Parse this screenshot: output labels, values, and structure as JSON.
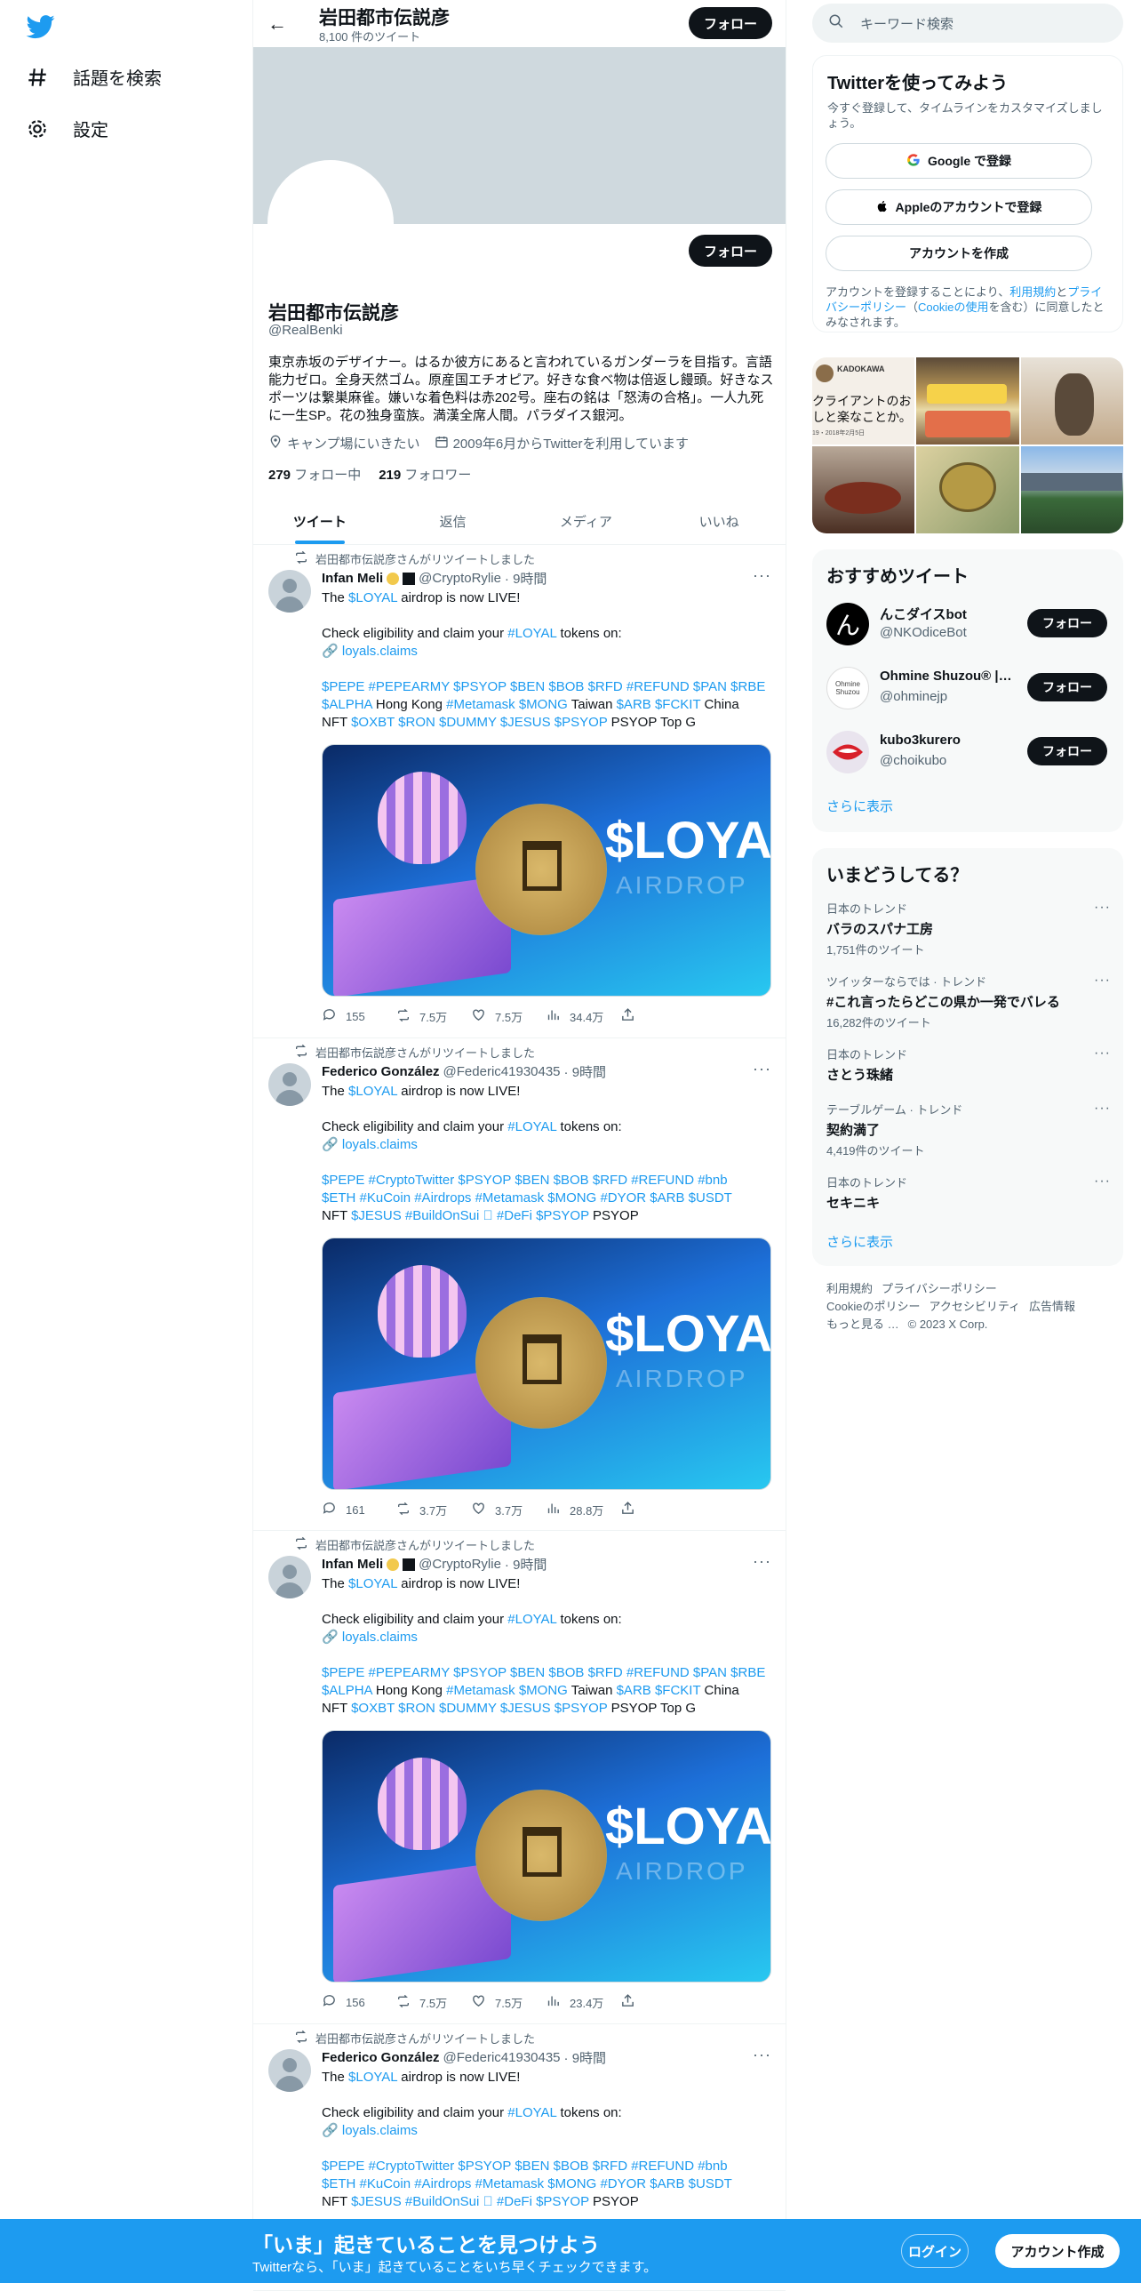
{
  "nav": {
    "items": [
      {
        "label": "話題を検索",
        "icon": "hashtag-icon"
      },
      {
        "label": "設定",
        "icon": "gear-icon"
      }
    ]
  },
  "topbar": {
    "title": "岩田都市伝説彦",
    "subtitle": "8,100 件のツイート",
    "follow": "フォロー"
  },
  "profile": {
    "follow": "フォロー",
    "name": "岩田都市伝説彦",
    "handle": "@RealBenki",
    "bio": "東京赤坂のデザイナー。はるか彼方にあると言われているガンダーラを目指す。言語能力ゼロ。全身天然ゴム。原産国エチオピア。好きな食べ物は倍返し饅頭。好きなスポーツは繋巣麻雀。嫌いな着色料は赤202号。座右の銘は「怒涛の合格」。一人九死に一生SP。花の独身蛮族。満漢全席人間。パラダイス銀河。",
    "location": "キャンプ場にいきたい",
    "joined": "2009年6月からTwitterを利用しています",
    "following_count": "279",
    "following_label": "フォロー中",
    "followers_count": "219",
    "followers_label": "フォロワー"
  },
  "tabs": [
    "ツイート",
    "返信",
    "メディア",
    "いいね"
  ],
  "tweets": [
    {
      "rt": "岩田都市伝説彦さんがリツイートしました",
      "name": "Infan Meli",
      "handle": "@CryptoRylie",
      "time": "· 9時間",
      "line1a": "The ",
      "line1b": "$LOYAL",
      "line1c": " airdrop is now LIVE!",
      "line2a": "Check eligibility and claim your ",
      "line2b": "#LOYAL",
      "line2c": " tokens on:",
      "link": "loyals.claims",
      "tags1": "$PEPE #PEPEARMY $PSYOP $BEN $BOB $RFD #REFUND $PAN $RBE",
      "tags2a": "$ALPHA",
      "tags2b": " Hong Kong ",
      "tags2c": "#Metamask $MONG",
      "tags2d": " Taiwan ",
      "tags2e": "$ARB $FCKIT",
      "tags2f": " China",
      "tags3a": "NFT ",
      "tags3b": "$OXBT $RON $DUMMY $JESUS $PSYOP",
      "tags3c": " PSYOP Top G",
      "image_text": "$LOYAL",
      "image_sub": "AIRDROP",
      "replies": "155",
      "retweets": "7.5万",
      "likes": "7.5万",
      "views": "34.4万"
    },
    {
      "rt": "岩田都市伝説彦さんがリツイートしました",
      "name": "Federico González",
      "handle": "@Federic41930435",
      "time": "· 9時間",
      "line1a": "The ",
      "line1b": "$LOYAL",
      "line1c": " airdrop is now LIVE!",
      "line2a": "Check eligibility and claim your ",
      "line2b": "#LOYAL",
      "line2c": " tokens on:",
      "link": "loyals.claims",
      "tags1": "$PEPE #CryptoTwitter $PSYOP $BEN $BOB $RFD #REFUND  #bnb",
      "tags2a": "$ETH  #KuCoin #Airdrops #Metamask $MONG #DYOR $ARB $USDT",
      "tags2b": "",
      "tags2c": "",
      "tags2d": "",
      "tags2e": "",
      "tags2f": "",
      "tags3a": "NFT ",
      "tags3b": "$JESUS #BuildOnSui ⃠ #DeFi $PSYOP",
      "tags3c": " PSYOP",
      "image_text": "$LOYAL",
      "image_sub": "AIRDROP",
      "replies": "161",
      "retweets": "3.7万",
      "likes": "3.7万",
      "views": "28.8万"
    },
    {
      "rt": "岩田都市伝説彦さんがリツイートしました",
      "name": "Infan Meli",
      "handle": "@CryptoRylie",
      "time": "· 9時間",
      "line1a": "The ",
      "line1b": "$LOYAL",
      "line1c": " airdrop is now LIVE!",
      "line2a": "Check eligibility and claim your ",
      "line2b": "#LOYAL",
      "line2c": " tokens on:",
      "link": "loyals.claims",
      "tags1": "$PEPE #PEPEARMY $PSYOP $BEN $BOB $RFD #REFUND $PAN $RBE",
      "tags2a": "$ALPHA",
      "tags2b": " Hong Kong ",
      "tags2c": "#Metamask $MONG",
      "tags2d": " Taiwan ",
      "tags2e": "$ARB $FCKIT",
      "tags2f": " China",
      "tags3a": "NFT ",
      "tags3b": "$OXBT $RON $DUMMY $JESUS $PSYOP",
      "tags3c": " PSYOP Top G",
      "image_text": "$LOYAL",
      "image_sub": "AIRDROP",
      "replies": "156",
      "retweets": "7.5万",
      "likes": "7.5万",
      "views": "23.4万"
    },
    {
      "rt": "岩田都市伝説彦さんがリツイートしました",
      "name": "Federico González",
      "handle": "@Federic41930435",
      "time": "· 9時間",
      "line1a": "The ",
      "line1b": "$LOYAL",
      "line1c": " airdrop is now LIVE!",
      "line2a": "Check eligibility and claim your ",
      "line2b": "#LOYAL",
      "line2c": " tokens on:",
      "link": "loyals.claims",
      "tags1": "$PEPE #CryptoTwitter $PSYOP $BEN $BOB $RFD #REFUND  #bnb",
      "tags2a": "$ETH  #KuCoin #Airdrops #Metamask $MONG #DYOR $ARB $USDT",
      "tags2b": "",
      "tags2c": "",
      "tags2d": "",
      "tags2e": "",
      "tags2f": "",
      "tags3a": "NFT ",
      "tags3b": "$JESUS #BuildOnSui ⃠ #DeFi $PSYOP",
      "tags3c": " PSYOP",
      "image_text": "",
      "image_sub": "",
      "replies": "",
      "retweets": "",
      "likes": "",
      "views": ""
    }
  ],
  "right": {
    "search_placeholder": "キーワード検索",
    "signup": {
      "title": "Twitterを使ってみよう",
      "subtitle": "今すぐ登録して、タイムラインをカスタマイズしましょう。",
      "google": "Google で登録",
      "apple": "Appleのアカウントで登録",
      "create": "アカウントを作成",
      "legal_a": "アカウントを登録することにより、",
      "legal_terms": "利用規約",
      "legal_b": "と",
      "legal_privacy": "プライバシーポリシー",
      "legal_c": "（",
      "legal_cookie": "Cookieの使用",
      "legal_d": "を含む）に同意したとみなされます。"
    },
    "photos": {
      "p1_brand": "KADOKAWA",
      "p1_text": "クライアントのお\nしと楽なことか。",
      "p1_date": "19・2018年2月5日"
    },
    "recommend": {
      "title": "おすすめツイート",
      "users": [
        {
          "name": "んこダイスbot",
          "handle": "@NKOdiceBot",
          "follow": "フォロー",
          "avatar_text": "ん"
        },
        {
          "name": "Ohmine Shuzou® | ...",
          "handle": "@ohminejp",
          "follow": "フォロー",
          "avatar_text": "Ohmine Shuzou"
        },
        {
          "name": "kubo3kurero",
          "handle": "@choikubo",
          "follow": "フォロー",
          "avatar_text": ""
        }
      ],
      "more": "さらに表示"
    },
    "trends": {
      "title": "いまどうしてる？",
      "items": [
        {
          "context": "日本のトレンド",
          "name": "バラのスパナ工房",
          "posts": "1,751件のツイート"
        },
        {
          "context": "ツイッターならでは · トレンド",
          "name": "#これ言ったらどこの県か一発でバレる",
          "posts": "16,282件のツイート"
        },
        {
          "context": "日本のトレンド",
          "name": "さとう珠緒",
          "posts": ""
        },
        {
          "context": "テーブルゲーム · トレンド",
          "name": "契約満了",
          "posts": "4,419件のツイート"
        },
        {
          "context": "日本のトレンド",
          "name": "セキニキ",
          "posts": ""
        }
      ],
      "more": "さらに表示"
    },
    "footer": [
      "利用規約",
      "プライバシーポリシー",
      "Cookieのポリシー",
      "アクセシビリティ",
      "広告情報",
      "もっと見る …",
      "© 2023 X Corp."
    ]
  },
  "bottom": {
    "title": "「いま」起きていることを見つけよう",
    "subtitle": "Twitterなら、「いま」起きていることをいち早くチェックできます。",
    "login": "ログイン",
    "signup": "アカウント作成"
  },
  "colors": {
    "accent": "#1d9bf0",
    "dark": "#0f1419",
    "muted": "#536471"
  }
}
